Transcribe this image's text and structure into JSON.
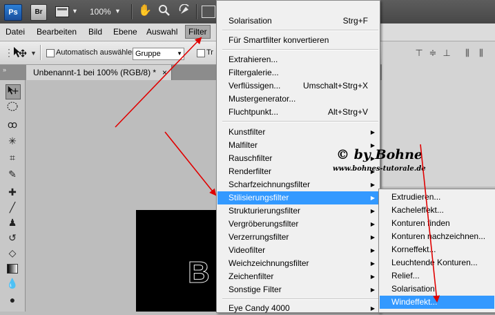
{
  "appbar": {
    "ps_logo": "Ps",
    "br_logo": "Br",
    "zoom": "100%",
    "icons": [
      "frame-icon",
      "hand-icon",
      "zoom-icon",
      "rotate-view-icon",
      "arrange-icon"
    ]
  },
  "menubar": {
    "items": [
      {
        "label": "Datei"
      },
      {
        "label": "Bearbeiten"
      },
      {
        "label": "Bild"
      },
      {
        "label": "Ebene"
      },
      {
        "label": "Auswahl"
      },
      {
        "label": "Filter",
        "active": true
      }
    ]
  },
  "options": {
    "auto_select_label": "Automatisch auswählen:",
    "auto_select_value": "Gruppe",
    "transform_label_partial": "Tr"
  },
  "document": {
    "tab_title": "Unbenannt-1 bei 100% (RGB/8) *",
    "close": "×"
  },
  "filter_menu": {
    "items": [
      {
        "label": "Solarisation",
        "shortcut": "Strg+F"
      },
      {
        "label": "Für Smartfilter konvertieren"
      },
      {
        "label": "Extrahieren..."
      },
      {
        "label": "Filtergalerie..."
      },
      {
        "label": "Verflüssigen...",
        "shortcut": "Umschalt+Strg+X"
      },
      {
        "label": "Mustergenerator..."
      },
      {
        "label": "Fluchtpunkt...",
        "shortcut": "Alt+Strg+V"
      },
      {
        "label": "Kunstfilter",
        "submenu": true
      },
      {
        "label": "Malfilter",
        "submenu": true
      },
      {
        "label": "Rauschfilter",
        "submenu": true
      },
      {
        "label": "Renderfilter",
        "submenu": true
      },
      {
        "label": "Scharfzeichnungsfilter",
        "submenu": true
      },
      {
        "label": "Stilisierungsfilter",
        "submenu": true,
        "highlighted": true
      },
      {
        "label": "Strukturierungsfilter",
        "submenu": true
      },
      {
        "label": "Vergröberungsfilter",
        "submenu": true
      },
      {
        "label": "Verzerrungsfilter",
        "submenu": true
      },
      {
        "label": "Videofilter",
        "submenu": true
      },
      {
        "label": "Weichzeichnungsfilter",
        "submenu": true
      },
      {
        "label": "Zeichenfilter",
        "submenu": true
      },
      {
        "label": "Sonstige Filter",
        "submenu": true
      },
      {
        "label": "Eye Candy 4000",
        "submenu": true
      }
    ]
  },
  "stylize_submenu": {
    "items": [
      {
        "label": "Extrudieren..."
      },
      {
        "label": "Kacheleffekt..."
      },
      {
        "label": "Konturen finden"
      },
      {
        "label": "Konturen nachzeichnen..."
      },
      {
        "label": "Korneffekt..."
      },
      {
        "label": "Leuchtende Konturen..."
      },
      {
        "label": "Relief..."
      },
      {
        "label": "Solarisation"
      },
      {
        "label": "Windeffekt...",
        "highlighted": true
      }
    ]
  },
  "watermark": {
    "line1": "© by Bohne",
    "line2": "www.bohnes-tutorale.de"
  },
  "canvas": {
    "glyph": "B"
  },
  "colors": {
    "highlight": "#3399ff",
    "arrow": "#e00000"
  }
}
